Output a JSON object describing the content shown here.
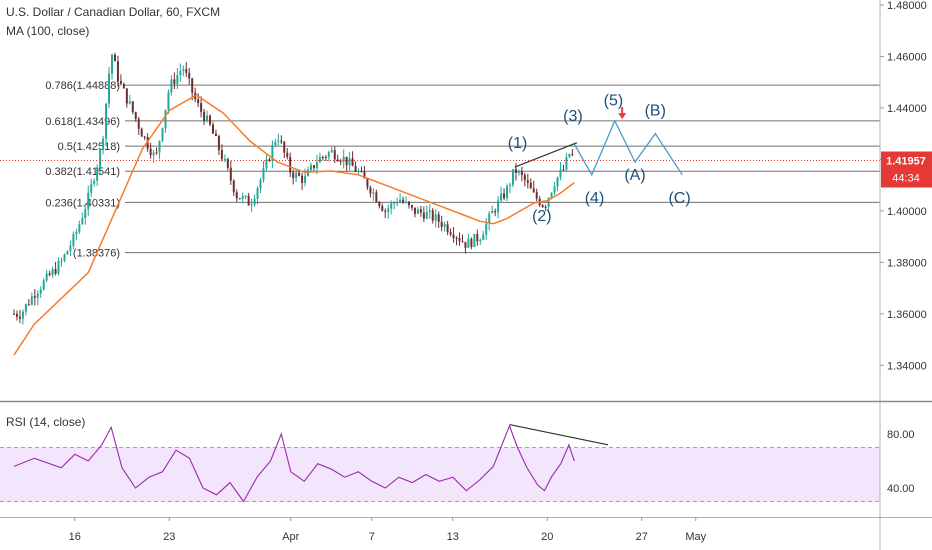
{
  "header": {
    "symbol_title": "U.S. Dollar / Canadian Dollar, 60, FXCM",
    "ma_label": "MA (100, close)",
    "rsi_label": "RSI (14, close)"
  },
  "colors": {
    "candle_up": "#26a69a",
    "candle_down": "#6b2f2f",
    "ma_line": "#f57c2a",
    "rsi_line": "#9c27b0",
    "rsi_band_fill": "#f3e5fb",
    "wave_projection": "#4a9cc7",
    "wave_labels": "#1f4f7a",
    "price_tag_bg": "#e53935",
    "fib_lines": "#707070",
    "trend_lines": "#333333",
    "down_arrow": "#e53935"
  },
  "chart_data": [
    {
      "type": "candlestick",
      "title": "U.S. Dollar / Canadian Dollar, 60, FXCM",
      "ylim": [
        1.33,
        1.48
      ],
      "y_ticks": [
        "1.48000",
        "1.46000",
        "1.44000",
        "1.42000",
        "1.40000",
        "1.38000",
        "1.36000",
        "1.34000"
      ],
      "x_ticks": [
        "16",
        "23",
        "Apr",
        "7",
        "13",
        "20",
        "27",
        "May"
      ],
      "x_tick_days": [
        16,
        23,
        32,
        38,
        44,
        51,
        58,
        62
      ],
      "current_price": "1.41957",
      "countdown": "44:34",
      "fib_levels": [
        {
          "label": "0.786(1.44888)",
          "value": 1.44888
        },
        {
          "label": "0.618(1.43496)",
          "value": 1.43496
        },
        {
          "label": "0.5(1.42518)",
          "value": 1.42518
        },
        {
          "label": "0.382(1.41541)",
          "value": 1.41541
        },
        {
          "label": "0.236(1.40331)",
          "value": 1.40331
        },
        {
          "label": "(1.38376)",
          "value": 1.38376
        }
      ],
      "price_path": [
        [
          12,
          1.36
        ],
        [
          13,
          1.368
        ],
        [
          14,
          1.374
        ],
        [
          15,
          1.38
        ],
        [
          16,
          1.39
        ],
        [
          17,
          1.405
        ],
        [
          18,
          1.425
        ],
        [
          18.7,
          1.462
        ],
        [
          19.3,
          1.45
        ],
        [
          20,
          1.442
        ],
        [
          21,
          1.43
        ],
        [
          22,
          1.42
        ],
        [
          23,
          1.448
        ],
        [
          24,
          1.456
        ],
        [
          25,
          1.442
        ],
        [
          26,
          1.433
        ],
        [
          27,
          1.42
        ],
        [
          28,
          1.406
        ],
        [
          29,
          1.403
        ],
        [
          30,
          1.415
        ],
        [
          31,
          1.43
        ],
        [
          32,
          1.415
        ],
        [
          33,
          1.412
        ],
        [
          34,
          1.42
        ],
        [
          35,
          1.423
        ],
        [
          36,
          1.42
        ],
        [
          37,
          1.415
        ],
        [
          38,
          1.408
        ],
        [
          39,
          1.4
        ],
        [
          40,
          1.405
        ],
        [
          41,
          1.4
        ],
        [
          42,
          1.399
        ],
        [
          43,
          1.396
        ],
        [
          44,
          1.392
        ],
        [
          45,
          1.387
        ],
        [
          46,
          1.39
        ],
        [
          47,
          1.4
        ],
        [
          48,
          1.408
        ],
        [
          48.6,
          1.416
        ],
        [
          49.3,
          1.412
        ],
        [
          50,
          1.406
        ],
        [
          50.8,
          1.402
        ],
        [
          51.6,
          1.412
        ],
        [
          52.2,
          1.416
        ],
        [
          52.7,
          1.423
        ],
        [
          53,
          1.4196
        ]
      ],
      "ma_path": [
        [
          11.5,
          1.344
        ],
        [
          13,
          1.356
        ],
        [
          15,
          1.366
        ],
        [
          17,
          1.376
        ],
        [
          19,
          1.4
        ],
        [
          21,
          1.424
        ],
        [
          23,
          1.439
        ],
        [
          25,
          1.445
        ],
        [
          27,
          1.438
        ],
        [
          29,
          1.427
        ],
        [
          31,
          1.419
        ],
        [
          33,
          1.415
        ],
        [
          35,
          1.4155
        ],
        [
          37,
          1.414
        ],
        [
          39,
          1.41
        ],
        [
          41,
          1.406
        ],
        [
          43,
          1.402
        ],
        [
          45,
          1.398
        ],
        [
          46,
          1.396
        ],
        [
          47,
          1.395
        ],
        [
          48,
          1.397
        ],
        [
          49,
          1.4
        ],
        [
          50,
          1.403
        ],
        [
          51,
          1.404
        ],
        [
          52,
          1.407
        ],
        [
          53,
          1.411
        ]
      ],
      "wave_projection": [
        [
          53,
          1.426
        ],
        [
          54.3,
          1.414
        ],
        [
          56,
          1.435
        ],
        [
          57.5,
          1.419
        ],
        [
          59,
          1.43
        ],
        [
          61,
          1.414
        ]
      ],
      "wave_labels": [
        {
          "text": "(1)",
          "x": 48.8,
          "y": 1.4245
        },
        {
          "text": "(2)",
          "x": 50.6,
          "y": 1.396
        },
        {
          "text": "(3)",
          "x": 52.9,
          "y": 1.435
        },
        {
          "text": "(4)",
          "x": 54.5,
          "y": 1.403
        },
        {
          "text": "(5)",
          "x": 55.9,
          "y": 1.441
        },
        {
          "text": "(A)",
          "x": 57.5,
          "y": 1.412
        },
        {
          "text": "(B)",
          "x": 59.0,
          "y": 1.437
        },
        {
          "text": "(C)",
          "x": 60.8,
          "y": 1.403
        }
      ],
      "trend_line": [
        [
          48.6,
          1.417
        ],
        [
          53.2,
          1.4265
        ]
      ]
    },
    {
      "type": "line",
      "title": "RSI (14, close)",
      "ylim": [
        20,
        100
      ],
      "y_ticks": [
        "80.00",
        "40.00"
      ],
      "band": [
        30,
        70
      ],
      "rsi_path": [
        [
          11.5,
          56
        ],
        [
          13,
          62
        ],
        [
          15,
          55
        ],
        [
          16,
          65
        ],
        [
          17,
          60
        ],
        [
          18,
          72
        ],
        [
          18.7,
          85
        ],
        [
          19.5,
          55
        ],
        [
          20.5,
          40
        ],
        [
          21.5,
          48
        ],
        [
          22.5,
          52
        ],
        [
          23.5,
          68
        ],
        [
          24.5,
          62
        ],
        [
          25.5,
          40
        ],
        [
          26.5,
          35
        ],
        [
          27.5,
          44
        ],
        [
          28.5,
          30
        ],
        [
          29.5,
          48
        ],
        [
          30.5,
          60
        ],
        [
          31.3,
          80
        ],
        [
          32,
          52
        ],
        [
          33,
          45
        ],
        [
          34,
          58
        ],
        [
          35,
          54
        ],
        [
          36,
          48
        ],
        [
          37,
          52
        ],
        [
          38,
          45
        ],
        [
          39,
          40
        ],
        [
          40,
          48
        ],
        [
          41,
          44
        ],
        [
          42,
          50
        ],
        [
          43,
          45
        ],
        [
          44,
          48
        ],
        [
          45,
          38
        ],
        [
          46,
          46
        ],
        [
          47,
          56
        ],
        [
          48.2,
          86
        ],
        [
          48.8,
          70
        ],
        [
          49.5,
          55
        ],
        [
          50.3,
          42
        ],
        [
          50.8,
          38
        ],
        [
          51.3,
          48
        ],
        [
          52,
          58
        ],
        [
          52.6,
          72
        ],
        [
          53,
          60
        ]
      ],
      "divergence_line": [
        [
          48.2,
          87
        ],
        [
          55.5,
          72
        ]
      ]
    }
  ]
}
